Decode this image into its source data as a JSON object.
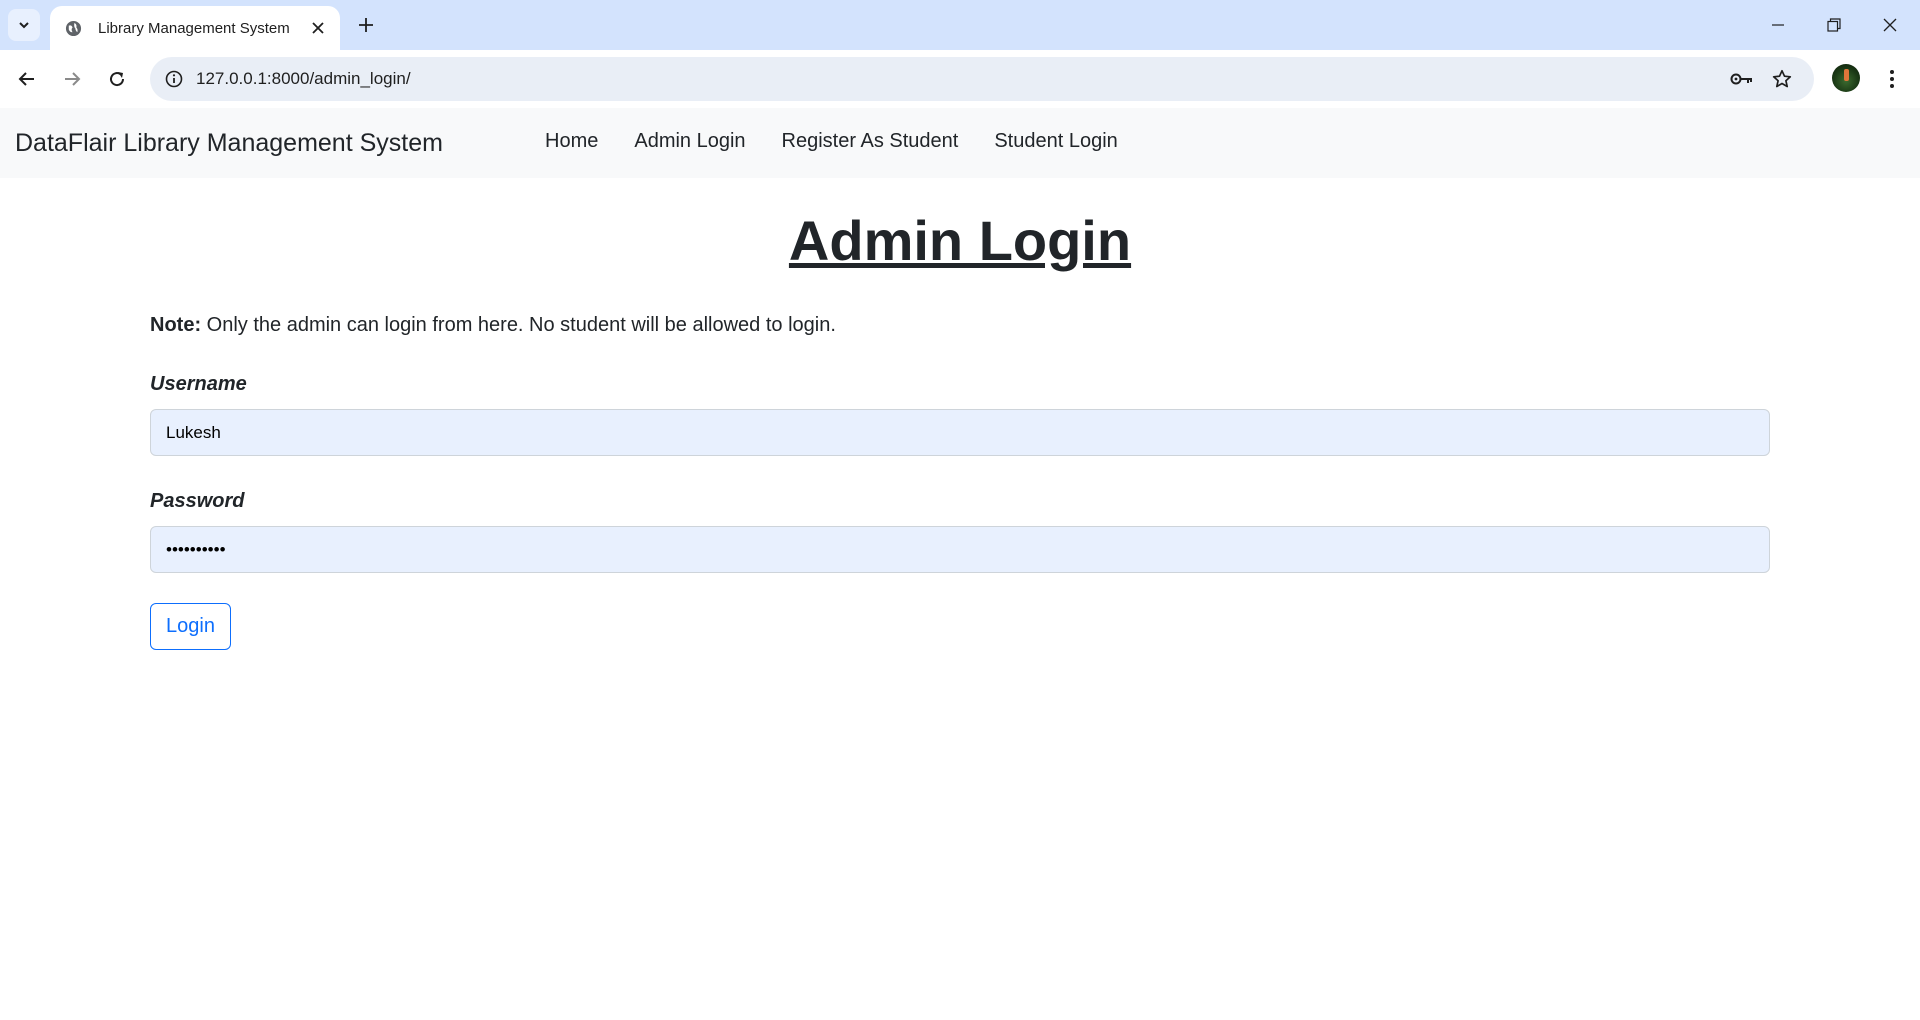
{
  "browser": {
    "tab_title": "Library Management System",
    "url": "127.0.0.1:8000/admin_login/"
  },
  "navbar": {
    "brand": "DataFlair Library Management System",
    "links": [
      "Home",
      "Admin Login",
      "Register As Student",
      "Student Login"
    ]
  },
  "page": {
    "heading": "Admin Login",
    "note_label": "Note:",
    "note_text": " Only the admin can login from here. No student will be allowed to login.",
    "username_label": "Username",
    "username_value": "Lukesh",
    "password_label": "Password",
    "password_value": "••••••••••",
    "login_button": "Login"
  },
  "colors": {
    "tabbar_bg": "#d3e3fd",
    "navbar_bg": "#f8f9fa",
    "input_bg": "#e8f0fe",
    "primary": "#0d6efd"
  }
}
